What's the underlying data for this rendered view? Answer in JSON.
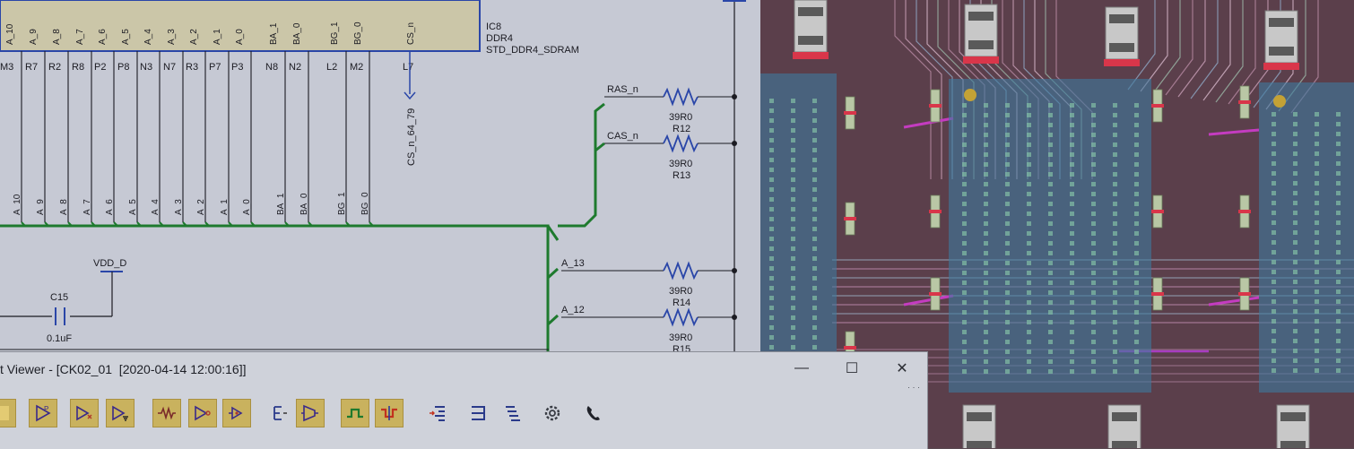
{
  "schematic": {
    "ic": {
      "ref": "IC8",
      "type": "DDR4",
      "part": "STD_DDR4_SDRAM",
      "pin_names": [
        "A_10",
        "A_9",
        "A_8",
        "A_7",
        "A_6",
        "A_5",
        "A_4",
        "A_3",
        "A_2",
        "A_1",
        "A_0",
        "BA_1",
        "BA_0",
        "BG_1",
        "BG_0",
        "CS_n"
      ],
      "pin_numbers": [
        "M3",
        "R7",
        "R2",
        "R8",
        "P2",
        "P8",
        "N3",
        "N7",
        "R3",
        "P7",
        "P3",
        "N8",
        "N2",
        "L2",
        "M2",
        "L7"
      ]
    },
    "net_labels": [
      "A_10",
      "A_9",
      "A_8",
      "A_7",
      "A_6",
      "A_5",
      "A_4",
      "A_3",
      "A_2",
      "A_1",
      "A_0",
      "BA_1",
      "BA_0",
      "BG_1",
      "BG_0"
    ],
    "cs_net": "CS_n_64_79",
    "resistors": [
      {
        "net": "RAS_n",
        "value": "39R0",
        "ref": "R12"
      },
      {
        "net": "CAS_n",
        "value": "39R0",
        "ref": "R13"
      },
      {
        "net": "A_13",
        "value": "39R0",
        "ref": "R14"
      },
      {
        "net": "A_12",
        "value": "39R0",
        "ref": "R15"
      }
    ],
    "power": "VDD_D",
    "capacitor": {
      "ref": "C15",
      "value": "0.1uF"
    }
  },
  "viewer": {
    "title": "t Viewer - [CK02_01  [2020-04-14 12:00:16]]",
    "minimize": "—",
    "maximize": "☐",
    "close": "✕",
    "grip": "· · ·"
  },
  "toolbar_icons": [
    "highlight-net-icon",
    "add-probe-icon",
    "pin-driver-icon",
    "pin-ground-icon",
    "resistor-icon",
    "buffer-icon",
    "inverter-icon",
    "edge-icon",
    "mux-icon",
    "net-trace-green-icon",
    "net-trace-red-icon",
    "align-left-icon",
    "align-right-icon",
    "list-icon",
    "settings-icon",
    "call-icon"
  ]
}
